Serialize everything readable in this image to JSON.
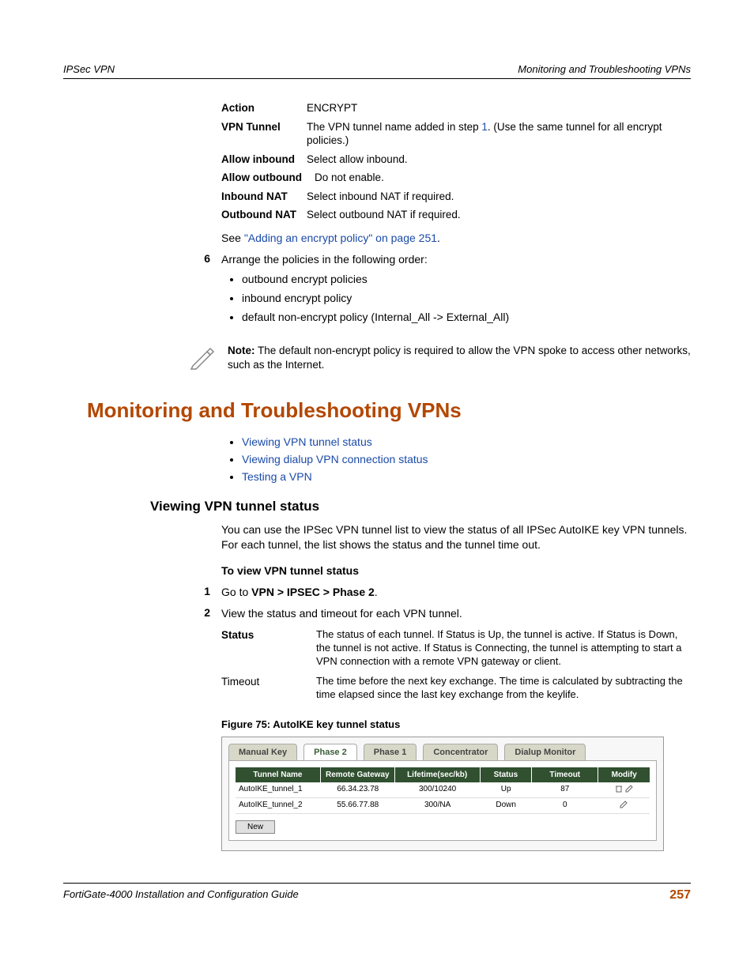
{
  "running_head": {
    "left": "IPSec VPN",
    "right": "Monitoring and Troubleshooting VPNs"
  },
  "params": {
    "action": {
      "label": "Action",
      "value": "ENCRYPT"
    },
    "vpn_tunnel": {
      "label": "VPN Tunnel",
      "value_pre": "The VPN tunnel name added in step ",
      "link": "1",
      "value_post": ". (Use the same tunnel for all encrypt policies.)"
    },
    "allow_inbound": {
      "label": "Allow inbound",
      "value": "Select allow inbound."
    },
    "allow_outbound": {
      "label": "Allow outbound",
      "value": "Do not enable."
    },
    "inbound_nat": {
      "label": "Inbound NAT",
      "value": "Select inbound NAT if required."
    },
    "outbound_nat": {
      "label": "Outbound NAT",
      "value": "Select outbound NAT if required."
    }
  },
  "see_line": {
    "pre": "See ",
    "link": "\"Adding an encrypt policy\" on page 251",
    "post": "."
  },
  "step6": {
    "num": "6",
    "text": "Arrange the policies in the following order:",
    "bullets": [
      "outbound encrypt policies",
      "inbound encrypt policy",
      "default non-encrypt policy (Internal_All -> External_All)"
    ]
  },
  "note": {
    "label": "Note:",
    "text": " The default non-encrypt policy is required to allow the VPN spoke to access other networks, such as the Internet."
  },
  "section_heading": "Monitoring and Troubleshooting VPNs",
  "section_links": [
    "Viewing VPN tunnel status",
    "Viewing dialup VPN connection status",
    "Testing a VPN"
  ],
  "sub_heading": "Viewing VPN tunnel status",
  "body_para": "You can use the IPSec VPN tunnel list to view the status of all IPSec AutoIKE key VPN tunnels. For each tunnel, the list shows the status and the tunnel time out.",
  "proc_title": "To view VPN tunnel status",
  "steps": [
    {
      "num": "1",
      "pre": "Go to ",
      "bold": "VPN > IPSEC > Phase 2",
      "post": "."
    },
    {
      "num": "2",
      "pre": "View the status and timeout for each VPN tunnel.",
      "bold": "",
      "post": ""
    }
  ],
  "defs": {
    "status": {
      "label": "Status",
      "value": "The status of each tunnel. If Status is Up, the tunnel is active. If Status is Down, the tunnel is not active. If Status is Connecting, the tunnel is attempting to start a VPN connection with a remote VPN gateway or client."
    },
    "timeout": {
      "label": "Timeout",
      "value": "The time before the next key exchange. The time is calculated by subtracting the time elapsed since the last key exchange from the keylife."
    }
  },
  "figure_caption": "Figure 75: AutoIKE key tunnel status",
  "figure": {
    "tabs": [
      "Manual Key",
      "Phase 2",
      "Phase 1",
      "Concentrator",
      "Dialup Monitor"
    ],
    "active_tab": 1,
    "columns": [
      "Tunnel Name",
      "Remote Gateway",
      "Lifetime(sec/kb)",
      "Status",
      "Timeout",
      "Modify"
    ],
    "rows": [
      {
        "name": "AutoIKE_tunnel_1",
        "gw": "66.34.23.78",
        "life": "300/10240",
        "status": "Up",
        "timeout": "87",
        "modify": "both"
      },
      {
        "name": "AutoIKE_tunnel_2",
        "gw": "55.66.77.88",
        "life": "300/NA",
        "status": "Down",
        "timeout": "0",
        "modify": "edit"
      }
    ],
    "new_btn": "New"
  },
  "footer": {
    "left": "FortiGate-4000 Installation and Configuration Guide",
    "right": "257"
  }
}
